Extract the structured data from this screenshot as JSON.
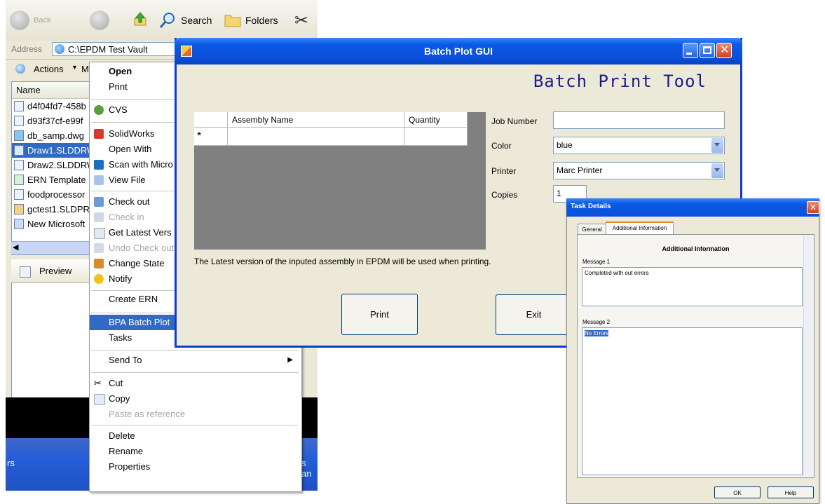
{
  "explorer": {
    "toolbar": {
      "back_label": "Back",
      "search_label": "Search",
      "folders_label": "Folders"
    },
    "address_label": "Address",
    "address_value": "C:\\EPDM Test Vault",
    "actions_label": "Actions",
    "actions_suffix": "M",
    "column_name": "Name",
    "files": [
      {
        "name": "d4f04fd7-458b"
      },
      {
        "name": "d93f37cf-e99f"
      },
      {
        "name": "db_samp.dwg"
      },
      {
        "name": "Draw1.SLDDRW"
      },
      {
        "name": "Draw2.SLDDRW"
      },
      {
        "name": "ERN Template"
      },
      {
        "name": "foodprocessor"
      },
      {
        "name": "gctest1.SLDPR"
      },
      {
        "name": "New Microsoft"
      }
    ],
    "preview_tab": "Preview",
    "taskbar_left": "rs",
    "taskbar_right": "s an"
  },
  "context_menu": {
    "open": "Open",
    "print": "Print",
    "cvs": "CVS",
    "solidworks": "SolidWorks",
    "open_with": "Open With",
    "scan": "Scan with Micro",
    "view_file": "View File",
    "check_out": "Check out",
    "check_in": "Check in",
    "get_latest": "Get Latest Vers",
    "undo_check_out": "Undo Check out",
    "change_state": "Change State",
    "notify": "Notify",
    "create_ern": "Create ERN",
    "bpa_batch_plot": "BPA Batch Plot",
    "tasks": "Tasks",
    "send_to": "Send To",
    "cut": "Cut",
    "copy": "Copy",
    "paste_as_reference": "Paste as reference",
    "delete": "Delete",
    "rename": "Rename",
    "properties": "Properties"
  },
  "batch_plot": {
    "window_title": "Batch Plot GUI",
    "heading": "Batch Print Tool",
    "grid": {
      "col_assembly": "Assembly Name",
      "col_quantity": "Quantity",
      "new_row_marker": "*"
    },
    "job_number_label": "Job Number",
    "job_number_value": "",
    "color_label": "Color",
    "color_value": "blue",
    "printer_label": "Printer",
    "printer_value": "Marc Printer",
    "copies_label": "Copies",
    "copies_value": "1",
    "note": "The Latest version of the inputed assembly in EPDM will be used when printing.",
    "print_button": "Print",
    "exit_button": "Exit"
  },
  "task_details": {
    "title": "Task Details",
    "tab_general": "General",
    "tab_additional": "Additional Information",
    "section_title": "Additional Information",
    "message1_label": "Message 1",
    "message1_value": "Completed with out errors",
    "message2_label": "Message 2",
    "message2_value": "No Errors",
    "ok_button": "OK",
    "help_button": "Help"
  },
  "colors": {
    "xp_blue": "#0b4fdb",
    "selection": "#316ac5",
    "dialog_bg": "#ece9d8",
    "close_red": "#e0432a"
  }
}
